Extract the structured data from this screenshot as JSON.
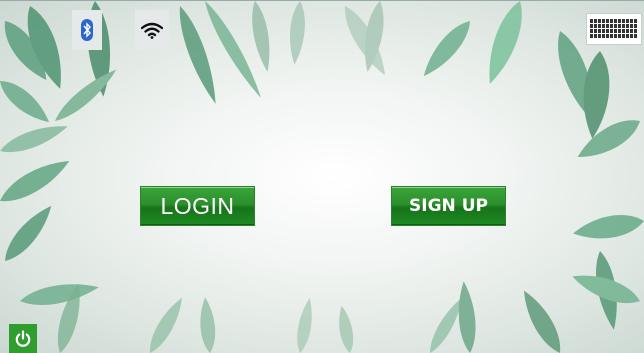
{
  "status_bar": {
    "bluetooth_icon": "bluetooth-icon",
    "wifi_icon": "wifi-icon",
    "keyboard_icon": "keyboard-icon"
  },
  "actions": {
    "login_label": "LOGIN",
    "signup_label": "SIGN UP"
  },
  "footer": {
    "power_icon": "power-icon"
  },
  "colors": {
    "button_green": "#1e8a22",
    "power_green": "#2f9e2f",
    "leaf_green": "#5fa882"
  }
}
